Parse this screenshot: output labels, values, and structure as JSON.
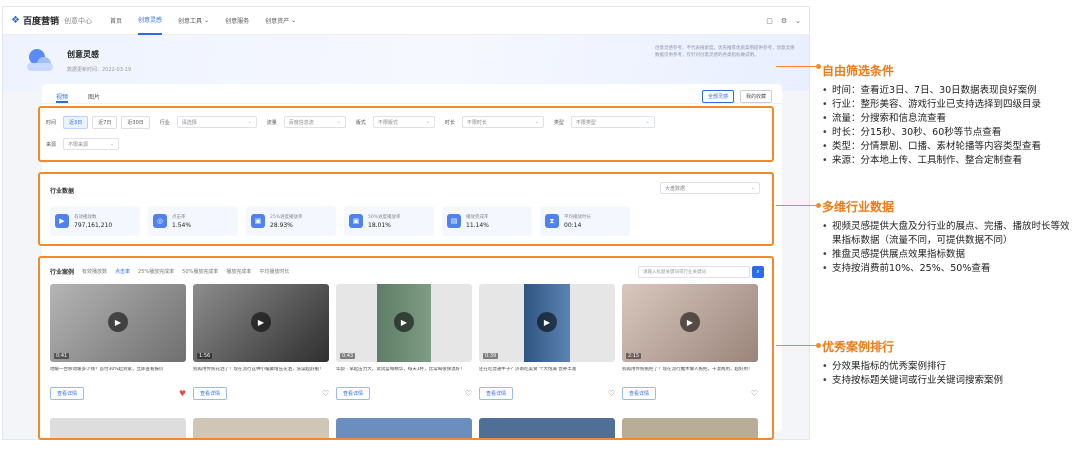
{
  "topnav": {
    "logo_mark": "❖",
    "logo_text": "百度营销",
    "logo_sub": "创意中心",
    "items": [
      {
        "label": "首页",
        "arrow": ""
      },
      {
        "label": "创意灵感",
        "arrow": ""
      },
      {
        "label": "创意工具",
        "arrow": "⌄"
      },
      {
        "label": "创意服务",
        "arrow": ""
      },
      {
        "label": "创意资产",
        "arrow": "⌄"
      }
    ],
    "right_icons": [
      "▢",
      "⚙",
      "⌄"
    ]
  },
  "hero": {
    "title": "创意灵感",
    "date": "数据更新时间：2022-03-19",
    "desc": "创意灵感参考，不代表搜索度。优先推荐优质案例提供参考，创意灵感数据仅供参考，仅针对创意灵感的各类指标做说明。"
  },
  "tabs": {
    "items": [
      "视频",
      "图片"
    ],
    "right_buttons": [
      "全部灵感",
      "我的收藏"
    ]
  },
  "filters": {
    "time_label": "时间",
    "time_chips": [
      "近3日",
      "近7日",
      "近30日"
    ],
    "industry_label": "行业",
    "industry_placeholder": "请选择",
    "traffic_label": "流量",
    "traffic_value": "百度信息流",
    "style_label": "版式",
    "style_value": "不限版式",
    "duration_label": "时长",
    "duration_value": "不限时长",
    "type_label": "类型",
    "type_value": "不限类型",
    "source_label": "来源",
    "source_value": "不限来源"
  },
  "industry": {
    "title": "行业数据",
    "select_value": "大盘数据",
    "metrics": [
      {
        "label": "有效播放数",
        "value": "797,161,210",
        "icon": "▶"
      },
      {
        "label": "点击率",
        "value": "1.54%",
        "icon": "◎"
      },
      {
        "label": "25%进度播放率",
        "value": "28.93%",
        "icon": "▣"
      },
      {
        "label": "50%进度播放率",
        "value": "18.01%",
        "icon": "▣"
      },
      {
        "label": "播放完成率",
        "value": "11.14%",
        "icon": "▤"
      },
      {
        "label": "平均播放时长",
        "value": "00:14",
        "icon": "⧗"
      }
    ]
  },
  "cases": {
    "title": "行业案例",
    "sorts": [
      "有效播放数",
      "点击率",
      "25%播放完成率",
      "50%播放完成率",
      "播放完成率",
      "平均播放时长"
    ],
    "search_placeholder": "请输入标题关键词或行业关键词",
    "search_icon": "⌕",
    "detail_label": "查看详情",
    "cards": [
      {
        "duration": "0:41",
        "caption": "地暖一台移动暖多少钱？首付30%起到家，立即查看报价",
        "bg": "#8c8c8c",
        "liked": true
      },
      {
        "duration": "1:56",
        "caption": "别再用传统花洒了！现在流行这种小偏簧增压花洒，洗澡超舒服！",
        "bg": "#5a5a5a",
        "liked": false
      },
      {
        "duration": "0:43",
        "caption": "年龄 · 早起压力大，试试蓝莓精华，每天1杯，比常喝很保温好！",
        "bg": "#6f8a75",
        "liked": false
      },
      {
        "duration": "0:39",
        "caption": "还在吃普通牛子？济南吃美食 个大饱满 营养丰富",
        "bg": "#3d5f8a",
        "liked": false
      },
      {
        "duration": "2:15",
        "caption": "别再用传统拖把了！现在流行魔术懒人拖把，干湿两用，超好用！",
        "bg": "#b9a39a",
        "liked": false
      }
    ]
  },
  "annotations": [
    {
      "title": "自由筛选条件",
      "items": [
        "时间：查看近3日、7日、30日数据表现良好案例",
        "行业：整形美容、游戏行业已支持选择到四级目录",
        "流量：分搜索和信息流查看",
        "时长：分15秒、30秒、60秒等节点查看",
        "类型：分情景剧、口播、素材轮播等内容类型查看",
        "来源：分本地上传、工具制作、整合定制查看"
      ]
    },
    {
      "title": "多维行业数据",
      "items": [
        "视频灵感提供大盘及分行业的展点、完播、播放时长等效果指标数据（流量不同，可提供数据不同）",
        "推盘灵感提供展点效果指标数据",
        "支持按消费前10%、25%、50%查看"
      ]
    },
    {
      "title": "优秀案例排行",
      "items": [
        "分效果指标的优秀案例排行",
        "支持按标题关键词或行业关键词搜索案例"
      ]
    }
  ],
  "colors": {
    "accent": "#2b6de6",
    "highlight": "#f08a2c",
    "annot_title": "#f07a16"
  }
}
